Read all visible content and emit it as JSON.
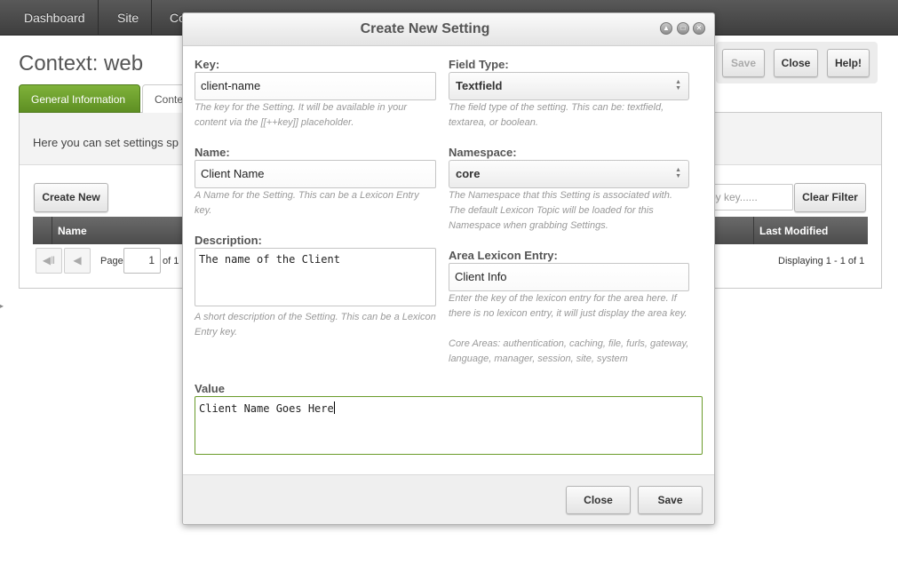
{
  "nav": {
    "items": [
      "Dashboard",
      "Site",
      "Co"
    ]
  },
  "page": {
    "title": "Context: web",
    "actions": {
      "save": "Save",
      "close": "Close",
      "help": "Help!"
    },
    "tabs": [
      "General Information",
      "Conte"
    ],
    "description": "Here you can set settings sp",
    "create_new": "Create New",
    "filter_placeholder": "by key......",
    "clear_filter": "Clear Filter",
    "grid": {
      "columns": [
        "Name",
        "Last Modified"
      ]
    },
    "pager": {
      "page_label": "Page",
      "page_value": "1",
      "of_label": "of 1",
      "displaying": "Displaying 1 - 1 of 1"
    }
  },
  "modal": {
    "title": "Create New Setting",
    "key": {
      "label": "Key:",
      "value": "client-name",
      "hint": "The key for the Setting. It will be available in your content via the [[++key]] placeholder."
    },
    "field_type": {
      "label": "Field Type:",
      "value": "Textfield",
      "hint": "The field type of the setting. This can be: textfield, textarea, or boolean."
    },
    "name": {
      "label": "Name:",
      "value": "Client Name",
      "hint": "A Name for the Setting. This can be a Lexicon Entry key."
    },
    "namespace": {
      "label": "Namespace:",
      "value": "core",
      "hint": "The Namespace that this Setting is associated with. The default Lexicon Topic will be loaded for this Namespace when grabbing Settings."
    },
    "description": {
      "label": "Description:",
      "value": "The name of the Client",
      "hint": "A short description of the Setting. This can be a Lexicon Entry key."
    },
    "area": {
      "label": "Area Lexicon Entry:",
      "value": "Client Info",
      "hint": "Enter the key of the lexicon entry for the area here. If there is no lexicon entry, it will just display the area key.",
      "hint2": "Core Areas: authentication, caching, file, furls, gateway, language, manager, session, site, system"
    },
    "value_field": {
      "label": "Value",
      "value": "Client Name Goes Here"
    },
    "buttons": {
      "close": "Close",
      "save": "Save"
    }
  },
  "colors": {
    "accent_green": "#6a9b2a",
    "nav_bg": "#4a4a4a",
    "grid_header": "#5a5a5a"
  }
}
